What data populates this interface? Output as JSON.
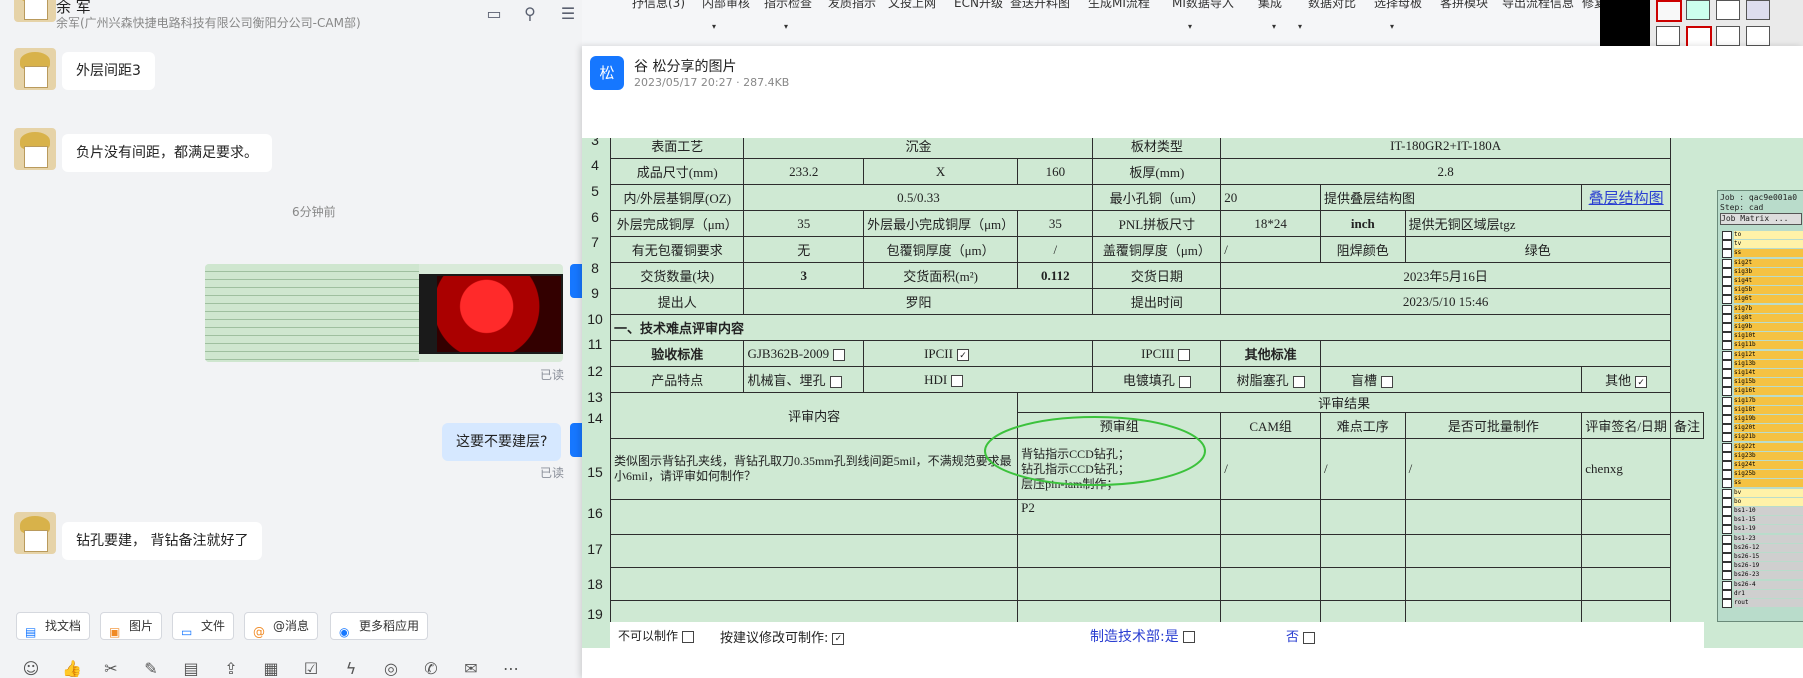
{
  "chat": {
    "header": {
      "name": "余 军",
      "subtitle": "余军(广州兴森快捷电路科技有限公司衡阳分公司-CAM部)"
    },
    "messages": [
      {
        "text": "外层间距3"
      },
      {
        "text": "负片没有间距，都满足要求。"
      },
      {
        "time": "6分钟前"
      },
      {
        "read": "已读"
      },
      {
        "text": "这要不要建层?"
      },
      {
        "read": "已读"
      },
      {
        "text": "钻孔要建， 背钻备注就好了"
      }
    ],
    "toolbar": [
      "找文档",
      "图片",
      "文件",
      "@消息",
      "更多稻应用"
    ]
  },
  "topstrip": [
    "抒信息(3)",
    "内部审核",
    "指示检查",
    "发质指示",
    "文投上网",
    "ECN开级",
    "查送开料图",
    "生成MI流程",
    "MI数据导入",
    "集成",
    "数据对比",
    "选择母板",
    "客拼模块",
    "导出流程信息",
    "修复ECN"
  ],
  "viewer": {
    "avatar": "松",
    "title": "谷 松分享的图片",
    "meta": "2023/05/17 20:27 · 287.4KB"
  },
  "sheet": {
    "row_numbers": [
      "3",
      "4",
      "5",
      "6",
      "7",
      "8",
      "9",
      "10",
      "11",
      "12",
      "13",
      "14",
      "15",
      "16",
      "17",
      "18",
      "19"
    ],
    "r3": [
      "表面工艺",
      "沉金",
      "板材类型",
      "IT-180GR2+IT-180A"
    ],
    "r4": [
      "成品尺寸(mm)",
      "233.2",
      "X",
      "160",
      "板厚(mm)",
      "2.8"
    ],
    "r5": [
      "内/外层基铜厚(OZ)",
      "0.5/0.33",
      "最小孔铜（um）",
      "20",
      "提供叠层结构图",
      "叠层结构图"
    ],
    "r6": [
      "外层完成铜厚（μm）",
      "35",
      "外层最小完成铜厚（μm）",
      "35",
      "PNL拼板尺寸",
      "18*24",
      "inch",
      "提供无铜区域层tgz"
    ],
    "r7": [
      "有无包覆铜要求",
      "无",
      "包覆铜厚度（μm）",
      "/",
      "盖覆铜厚度（μm）",
      "/",
      "阻焊颜色",
      "绿色"
    ],
    "r8": [
      "交货数量(块)",
      "3",
      "交货面积(m²)",
      "0.112",
      "交货日期",
      "2023年5月16日"
    ],
    "r9": [
      "提出人",
      "罗阳",
      "提出时间",
      "2023/5/10 15:46"
    ],
    "r10": "一、技术难点评审内容",
    "r11": [
      "验收标准",
      "GJB362B-2009",
      "IPCII",
      "IPCIII",
      "其他标准"
    ],
    "r12": [
      "产品特点",
      "机械盲、埋孔",
      "HDI",
      "电镀填孔",
      "树脂塞孔",
      "盲槽",
      "其他"
    ],
    "r13": [
      "评审内容",
      "评审结果"
    ],
    "r14": [
      "预审组",
      "CAM组",
      "难点工序",
      "是否可批量制作",
      "评审签名/日期",
      "备注"
    ],
    "r15": {
      "content": "类似图示背钻孔夹线，背钻孔取刀0.35mm孔到线间距5mil，不满规范要求最小6mil，请评审如何制作？",
      "pre1": "背钻指示CCD钻孔；",
      "pre2": "钻孔指示CCD钻孔；",
      "pre3": "层压pin-lam制作；",
      "cam": "/",
      "diff": "/",
      "batch": "/",
      "sign": "chenxg"
    },
    "r16": "P2",
    "footer": [
      "不可以制作",
      "按建议修改可制作:",
      "制造技术部:是",
      "否"
    ]
  },
  "cam": {
    "title": "Job : qac9e001a0",
    "step": "Step: cad",
    "matrix": "Job Matrix ...",
    "layers": [
      "to",
      "tv",
      "ss",
      "sig2t",
      "sig3b",
      "sig4t",
      "sig5b",
      "sig6t",
      "sig7b",
      "sig8t",
      "sig9b",
      "sig10t",
      "sig11b",
      "sig12t",
      "sig13b",
      "sig14t",
      "sig15b",
      "sig16t",
      "sig17b",
      "sig18t",
      "sig19b",
      "sig20t",
      "sig21b",
      "sig22t",
      "sig23b",
      "sig24t",
      "sig25b",
      "ss",
      "bv",
      "bo",
      "bs1-10",
      "bs1-15",
      "bs1-19",
      "bs1-23",
      "bs26-12",
      "bs26-15",
      "bs26-19",
      "bs26-23",
      "bs26-4",
      "dr1",
      "rout"
    ]
  },
  "colors": {
    "accent": "#1677ff",
    "sheet_bg": "#cfe9d3",
    "ellipse": "#3cc23c"
  }
}
